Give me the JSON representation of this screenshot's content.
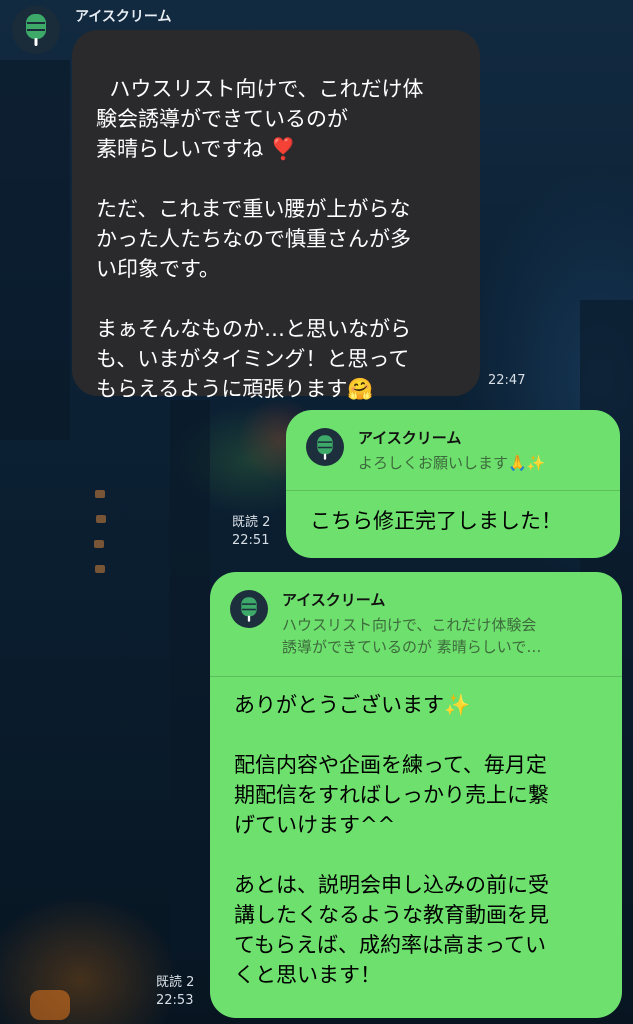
{
  "chat": {
    "sender_name": "アイスクリーム",
    "avatar_icon": "ice-cream-icon",
    "messages": [
      {
        "direction": "incoming",
        "text": "ハウスリスト向けで、これだけ体\n験会誘導ができているのが\n素晴らしいですね ❣️\n\nただ、これまで重い腰が上がらな\nかった人たちなので慎重さんが多\nい印象です。\n\nまぁそんなものか…と思いながら\nも、いまがタイミング！と思って\nもらえるように頑張ります🤗",
        "time": "22:47"
      },
      {
        "direction": "outgoing",
        "quote": {
          "name": "アイスクリーム",
          "text": "よろしくお願いします🙏✨"
        },
        "text": "こちら修正完了しました！",
        "read": "既読 2",
        "time": "22:51"
      },
      {
        "direction": "outgoing",
        "quote": {
          "name": "アイスクリーム",
          "text": "ハウスリスト向けで、これだけ体験会\n誘導ができているのが 素晴らしいで…"
        },
        "text": "ありがとうございます✨\n\n配信内容や企画を練って、毎月定\n期配信をすればしっかり売上に繋\nげていけます^^\n\nあとは、説明会申し込みの前に受\n講したくなるような教育動画を見\nてもらえば、成約率は高まってい\nくと思います！",
        "read": "既読 2",
        "time": "22:53"
      }
    ]
  },
  "colors": {
    "incoming_bubble": "#2a2a2c",
    "outgoing_bubble": "#6ee06d",
    "avatar_icon": "#3daa6a",
    "background": "#0b1a2a"
  }
}
